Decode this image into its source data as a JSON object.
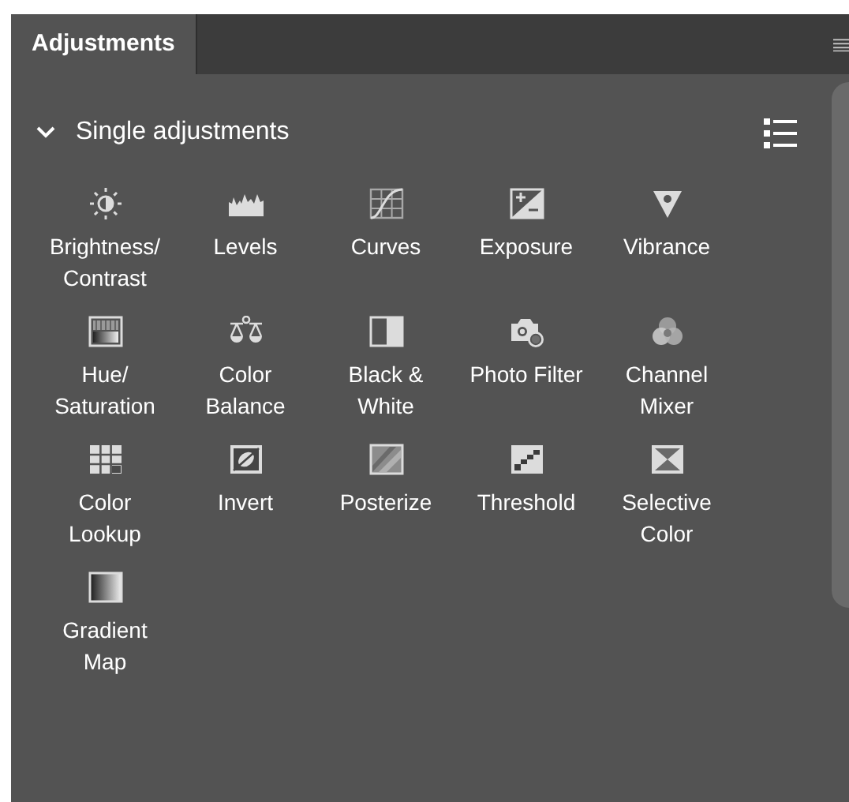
{
  "tabs": [
    {
      "label": "Adjustments",
      "selected": true
    }
  ],
  "section": {
    "title": "Single adjustments",
    "expanded": true
  },
  "items": [
    {
      "label": "Brightness/\nContrast",
      "kind": "brightness"
    },
    {
      "label": "Levels",
      "kind": "levels"
    },
    {
      "label": "Curves",
      "kind": "curves"
    },
    {
      "label": "Exposure",
      "kind": "exposure"
    },
    {
      "label": "Vibrance",
      "kind": "vibrance"
    },
    {
      "label": "Hue/\nSaturation",
      "kind": "hue"
    },
    {
      "label": "Color\nBalance",
      "kind": "balance"
    },
    {
      "label": "Black &\nWhite",
      "kind": "bw"
    },
    {
      "label": "Photo Filter",
      "kind": "photo"
    },
    {
      "label": "Channel\nMixer",
      "kind": "mixer"
    },
    {
      "label": "Color\nLookup",
      "kind": "lookup"
    },
    {
      "label": "Invert",
      "kind": "invert"
    },
    {
      "label": "Posterize",
      "kind": "posterize"
    },
    {
      "label": "Threshold",
      "kind": "threshold"
    },
    {
      "label": "Selective\nColor",
      "kind": "selective"
    },
    {
      "label": "Gradient\nMap",
      "kind": "gradient"
    }
  ]
}
